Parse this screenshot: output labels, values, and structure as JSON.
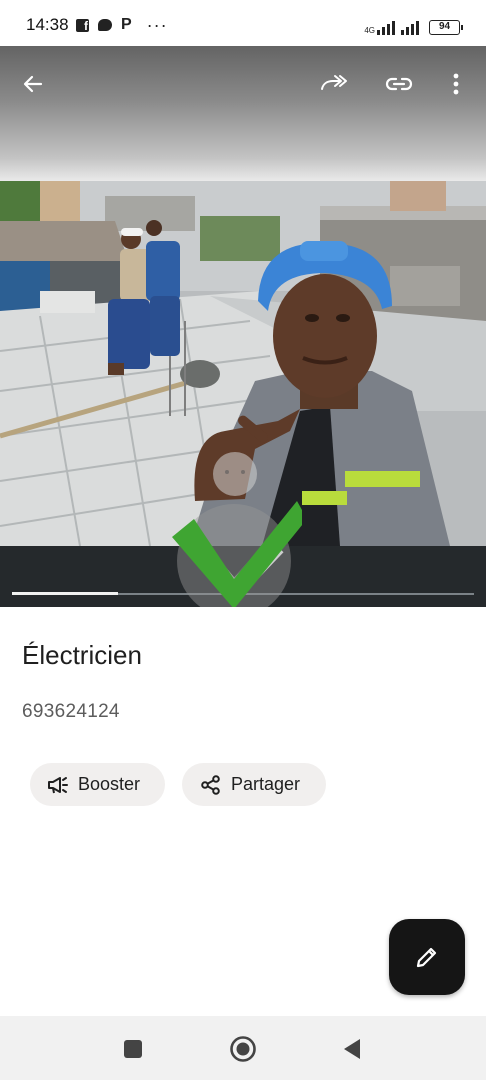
{
  "status_bar": {
    "time": "14:38",
    "icons": [
      "facebook-icon",
      "messenger-icon",
      "p-icon",
      "more-notifications-icon"
    ],
    "network": "4G",
    "battery": "94"
  },
  "toolbar": {
    "icons": [
      "back-arrow-icon",
      "forward-icon",
      "link-icon",
      "more-vert-icon"
    ]
  },
  "player": {
    "progress_fraction": 0.23
  },
  "post": {
    "title": "Électricien",
    "phone": "693624124"
  },
  "actions": {
    "boost_label": "Booster",
    "share_label": "Partager"
  },
  "fab": {
    "icon": "edit-pencil-icon"
  },
  "colors": {
    "accent_check": "#3fa532",
    "fab_bg": "#151515",
    "chip_bg": "#f1efee",
    "player_bar": "#25292c"
  }
}
